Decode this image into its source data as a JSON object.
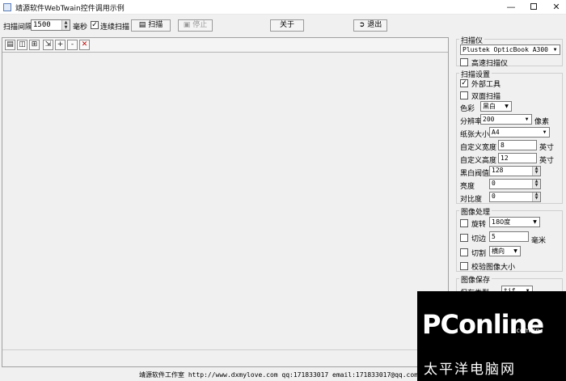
{
  "window": {
    "title": "靖源软件WebTwain控件调用示例"
  },
  "toolbar": {
    "interval_label": "扫描间隔",
    "interval_value": "1500",
    "interval_unit": "毫秒",
    "continuous_label": "连续扫描",
    "continuous_checked": "✓",
    "scan_label": "扫描",
    "stop_label": "停止",
    "about_label": "关于",
    "exit_label": "退出"
  },
  "scanner": {
    "title": "扫描仪",
    "device": "Plustek OpticBook A300",
    "highspeed_label": "高速扫描仪"
  },
  "settings": {
    "title": "扫描设置",
    "external_tool_label": "外部工具",
    "external_tool_checked": "✓",
    "duplex_label": "双面扫描",
    "color_label": "色彩",
    "color_value": "黑白",
    "resolution_label": "分辨率",
    "resolution_value": "200",
    "resolution_unit": "像素",
    "paper_label": "纸张大小",
    "paper_value": "A4",
    "custom_width_label": "自定义宽度",
    "custom_width_value": "8",
    "custom_width_unit": "英寸",
    "custom_height_label": "自定义高度",
    "custom_height_value": "12",
    "custom_height_unit": "英寸",
    "threshold_label": "黑白阀值",
    "threshold_value": "128",
    "brightness_label": "亮度",
    "brightness_value": "0",
    "contrast_label": "对比度",
    "contrast_value": "0"
  },
  "processing": {
    "title": "图像处理",
    "rotate_label": "旋转",
    "rotate_value": "180度",
    "crop_label": "切边",
    "crop_value": "5",
    "crop_unit": "毫米",
    "split_label": "切割",
    "split_value": "横向",
    "verify_label": "校验图像大小"
  },
  "save": {
    "title": "图像保存",
    "type_label": "保存类型",
    "type_value": "tif"
  },
  "status": {
    "text": "靖源软件工作室 http://www.dxmylove.com qq:171833017 email:171833017@qq.com 2018"
  },
  "watermark": {
    "logo": "PConline",
    "domain": ".com.cn",
    "chinese": "太平洋电脑网"
  }
}
